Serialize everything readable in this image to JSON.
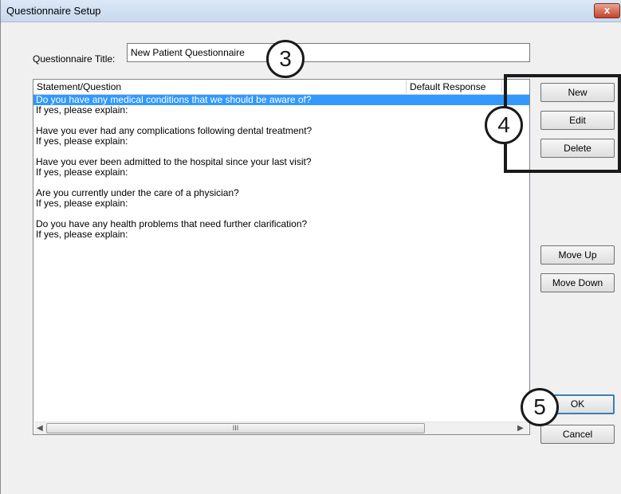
{
  "window": {
    "title": "Questionnaire Setup",
    "close_glyph": "x"
  },
  "form": {
    "title_label": "Questionnaire Title:",
    "title_value": "New Patient Questionnaire"
  },
  "list": {
    "columns": [
      "Statement/Question",
      "Default Response"
    ],
    "rows": [
      "Do you have any medical conditions that we should be aware of?",
      "If yes, please explain:",
      "",
      "Have you ever had any complications following dental treatment?",
      "If yes, please explain:",
      "",
      "Have you ever been admitted to the hospital since your last visit?",
      "If yes, please explain:",
      "",
      "Are you currently under the care of a physician?",
      "If yes, please explain:",
      "",
      "Do you have any health problems that need further clarification?",
      "If yes, please explain:"
    ],
    "selected_row_index": 0,
    "scroll_thumb_glyph": "III",
    "scroll_left_glyph": "◀",
    "scroll_right_glyph": "▶"
  },
  "buttons": {
    "new": "New",
    "edit": "Edit",
    "delete": "Delete",
    "move_up": "Move Up",
    "move_down": "Move Down",
    "ok": "OK",
    "cancel": "Cancel"
  },
  "callouts": {
    "one": "3",
    "two": "4",
    "three": "5"
  },
  "colors": {
    "selection": "#3399ff",
    "callout_border": "#1a1a1a"
  }
}
